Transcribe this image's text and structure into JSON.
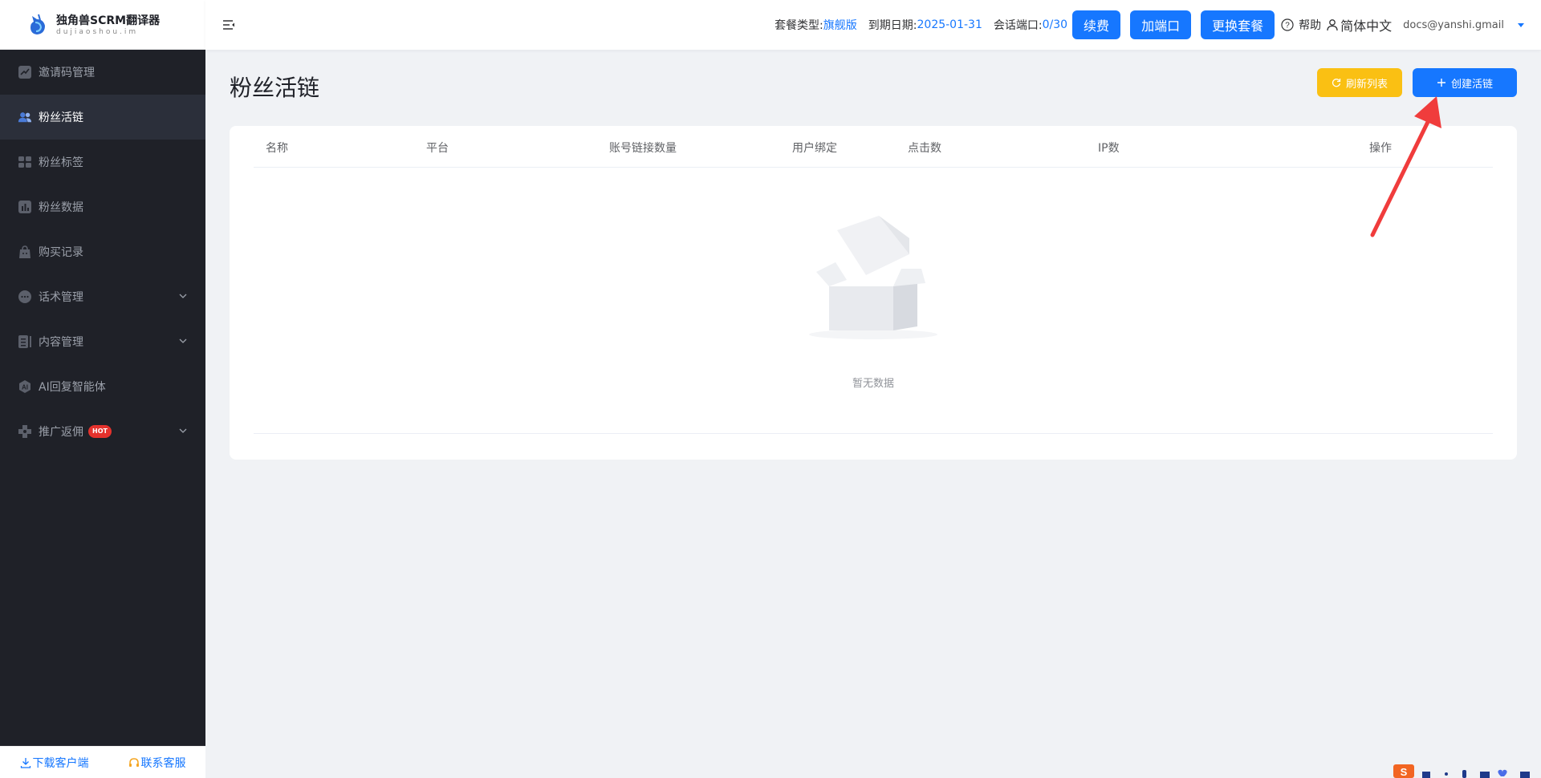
{
  "app": {
    "title": "独角兽SCRM翻译器",
    "subtitle": "dujiaoshou.im"
  },
  "sidebar": {
    "items": [
      {
        "label": "邀请码管理",
        "icon": "trend-chart-icon"
      },
      {
        "label": "粉丝活链",
        "icon": "users-icon"
      },
      {
        "label": "粉丝标签",
        "icon": "tag-icon"
      },
      {
        "label": "粉丝数据",
        "icon": "bar-chart-icon"
      },
      {
        "label": "购买记录",
        "icon": "shopping-bag-icon"
      },
      {
        "label": "话术管理",
        "icon": "chat-bubble-icon"
      },
      {
        "label": "内容管理",
        "icon": "document-icon"
      },
      {
        "label": "AI回复智能体",
        "icon": "ai-icon"
      },
      {
        "label": "推广返佣",
        "icon": "puzzle-icon",
        "badge": "HOT"
      }
    ],
    "footer": {
      "download": "下载客户端",
      "contact": "联系客服"
    }
  },
  "header": {
    "plan_label": "套餐类型:",
    "plan_value": "旗舰版",
    "expiry_label": "到期日期:",
    "expiry_value": "2025-01-31",
    "ports_label": "会话端口:",
    "ports_value": "0/30",
    "renew_button": "续费",
    "add_port_button": "加端口",
    "change_plan_button": "更换套餐",
    "help": "帮助",
    "language": "简体中文",
    "user_email": "docs@yanshi.gmail"
  },
  "main": {
    "page_title": "粉丝活链",
    "refresh_button": "刷新列表",
    "create_button": "创建活链",
    "table": {
      "columns": [
        "名称",
        "平台",
        "账号链接数量",
        "用户绑定",
        "点击数",
        "IP数",
        "操作"
      ]
    },
    "empty_text": "暂无数据"
  },
  "colors": {
    "accent": "#1677ff",
    "warning": "#fac013",
    "sidebar_bg": "#1f2128",
    "annotation_arrow": "#f03c3c"
  }
}
